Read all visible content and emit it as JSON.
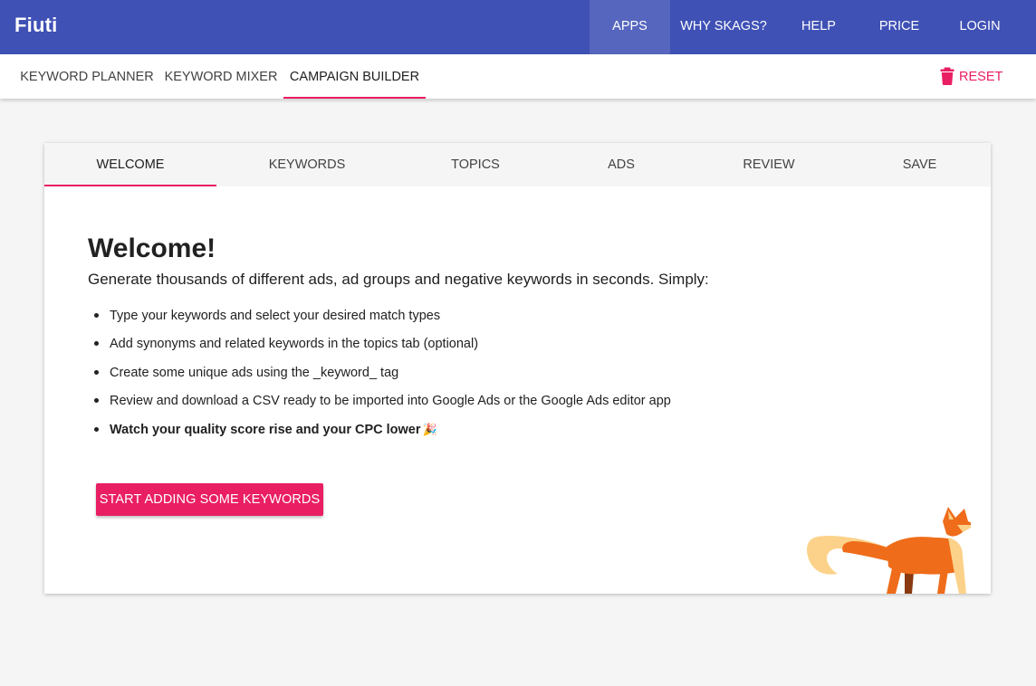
{
  "app": {
    "brand": "Fiuti"
  },
  "topnav": [
    {
      "label": "APPS",
      "active": true
    },
    {
      "label": "WHY SKAGS?",
      "active": false
    },
    {
      "label": "HELP",
      "active": false
    },
    {
      "label": "PRICE",
      "active": false
    },
    {
      "label": "LOGIN",
      "active": false
    }
  ],
  "subnav": {
    "tabs": [
      {
        "label": "KEYWORD PLANNER",
        "active": false
      },
      {
        "label": "KEYWORD MIXER",
        "active": false
      },
      {
        "label": "CAMPAIGN BUILDER",
        "active": true
      }
    ],
    "reset_label": "RESET"
  },
  "steps": [
    {
      "label": "WELCOME",
      "active": true
    },
    {
      "label": "KEYWORDS",
      "active": false
    },
    {
      "label": "TOPICS",
      "active": false
    },
    {
      "label": "ADS",
      "active": false
    },
    {
      "label": "REVIEW",
      "active": false
    },
    {
      "label": "SAVE",
      "active": false
    }
  ],
  "welcome": {
    "title": "Welcome!",
    "intro": "Generate thousands of different ads, ad groups and negative keywords in seconds. Simply:",
    "items": [
      "Type your keywords and select your desired match types",
      "Add synonyms and related keywords in the topics tab (optional)",
      "Create some unique ads using the _keyword_ tag",
      "Review and download a CSV ready to be imported into Google Ads or the Google Ads editor app",
      "Watch your quality score rise and your CPC lower"
    ],
    "emoji": "🎉",
    "cta_label": "START ADDING SOME KEYWORDS"
  },
  "colors": {
    "primary": "#3f51b5",
    "accent": "#e91e63",
    "background": "#f5f5f5"
  },
  "icons": {
    "reset": "trash-icon",
    "mascot": "fox-mascot"
  }
}
